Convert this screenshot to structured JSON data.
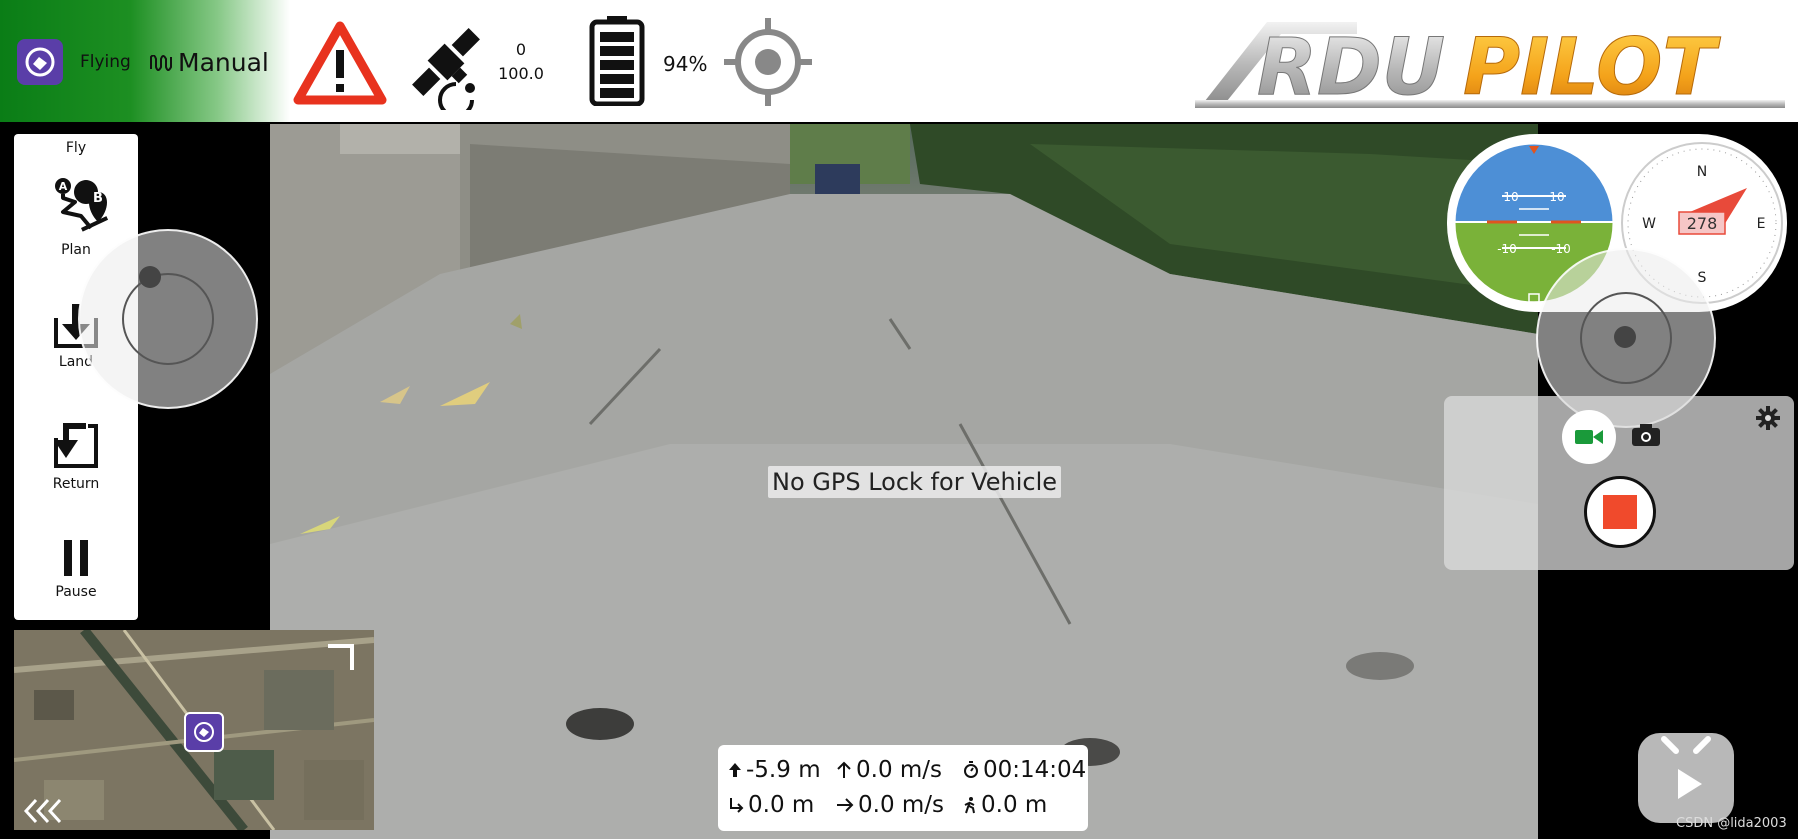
{
  "topbar": {
    "flight_state": "Flying",
    "mode": "Manual",
    "satellites": "0",
    "hdop": "100.0",
    "battery_percent": "94%",
    "logo_text": "ARDUPILOT",
    "green": "#0a7d16"
  },
  "toolbar": {
    "items": [
      {
        "label": "Fly",
        "icon": "fly"
      },
      {
        "label": "Plan",
        "icon": "route-a-b-icon"
      },
      {
        "label": "Land",
        "icon": "land-icon"
      },
      {
        "label": "Return",
        "icon": "return-icon"
      },
      {
        "label": "Pause",
        "icon": "pause-icon"
      }
    ]
  },
  "video": {
    "message": "No GPS Lock for Vehicle"
  },
  "attitude": {
    "pitch_marks": [
      "10",
      "10",
      "-10",
      "-10"
    ]
  },
  "compass": {
    "heading": "278",
    "cardinals": {
      "n": "N",
      "s": "S",
      "e": "E",
      "w": "W"
    }
  },
  "telemetry": {
    "altitude": "-5.9 m",
    "vertical_speed": "0.0 m/s",
    "flight_time": "00:14:04",
    "distance": "0.0 m",
    "ground_speed": "0.0 m/s",
    "distance_home": "0.0 m"
  },
  "camera": {
    "record_color": "#f04a2c",
    "video_color": "#1a9a3a"
  },
  "watermark": "CSDN @lida2003"
}
